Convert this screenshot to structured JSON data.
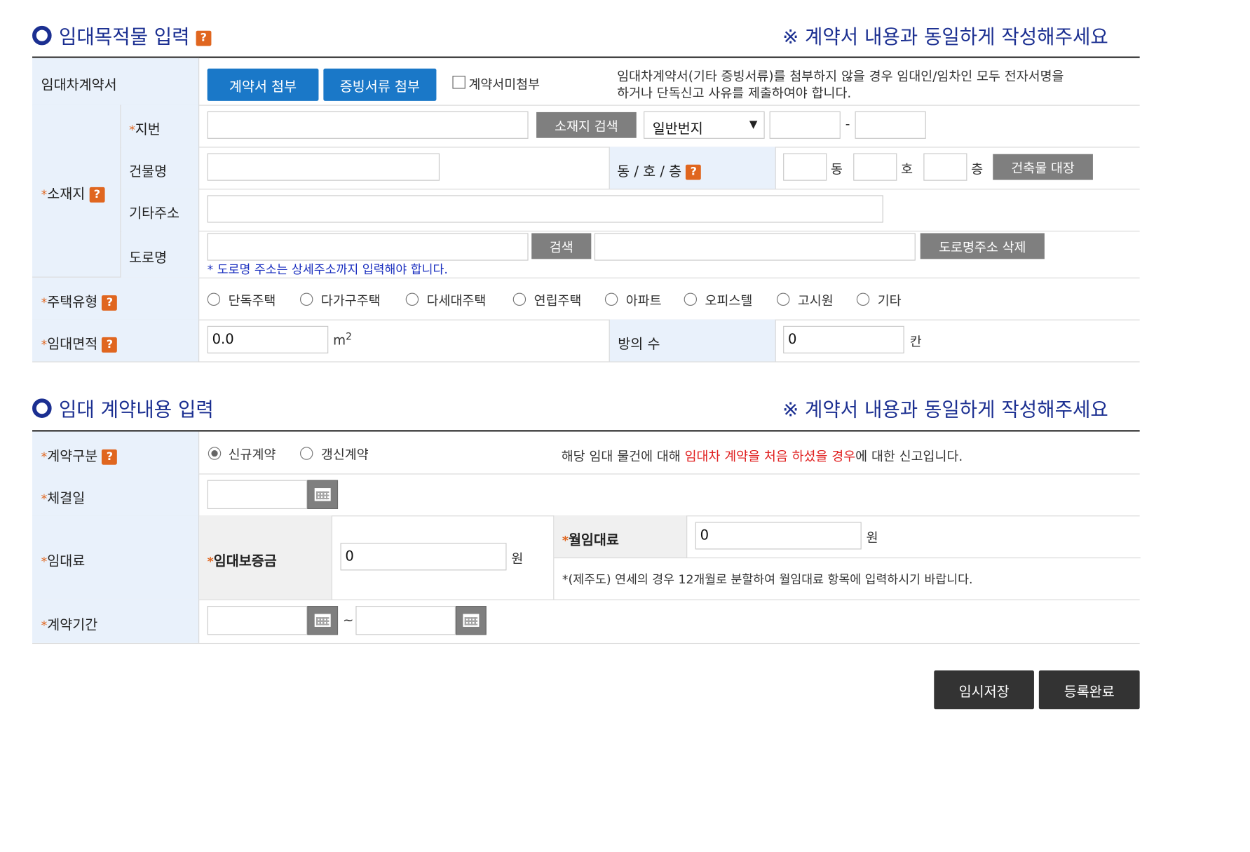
{
  "section1": {
    "title": "임대목적물 입력",
    "notice": "※ 계약서 내용과 동일하게 작성해주세요",
    "help": "?",
    "contract_label": "임대차계약서",
    "attach_contract_btn": "계약서 첨부",
    "attach_evidence_btn": "증빙서류 첨부",
    "no_attach_label": "계약서미첨부",
    "attach_note_1": "임대차계약서(기타 증빙서류)를 첨부하지 않을 경우 임대인/임차인 모두 전자서명을",
    "attach_note_2": "하거나 단독신고 사유를 제출하여야 합니다.",
    "location_label": "소재지",
    "jibun_label": "지번",
    "search_location_btn": "소재지 검색",
    "jibun_type_selected": "일반번지",
    "dash": "-",
    "building_name_label": "건물명",
    "dong_ho_floor_label": "동 / 호 / 층",
    "dong_unit": "동",
    "ho_unit": "호",
    "floor_unit": "층",
    "building_register_btn": "건축물 대장",
    "other_address_label": "기타주소",
    "road_label": "도로명",
    "road_search_btn": "검색",
    "road_delete_btn": "도로명주소 삭제",
    "road_note": "* 도로명 주소는 상세주소까지 입력해야 합니다.",
    "housing_type_label": "주택유형",
    "housing_types": [
      "단독주택",
      "다가구주택",
      "다세대주택",
      "연립주택",
      "아파트",
      "오피스텔",
      "고시원",
      "기타"
    ],
    "area_label": "임대면적",
    "area_value": "0.0",
    "area_unit": "m",
    "area_unit_sup": "2",
    "rooms_label": "방의 수",
    "rooms_value": "0",
    "rooms_unit": "칸"
  },
  "section2": {
    "title": "임대 계약내용 입력",
    "notice": "※ 계약서 내용과 동일하게 작성해주세요",
    "contract_type_label": "계약구분",
    "contract_types": [
      "신규계약",
      "갱신계약"
    ],
    "contract_type_selected": "신규계약",
    "contract_note_pre": "해당 임대 물건에 대해 ",
    "contract_note_red": "임대차 계약을 처음 하셨을 경우",
    "contract_note_post": "에 대한 신고입니다.",
    "conclusion_date_label": "체결일",
    "rent_label": "임대료",
    "deposit_label": "임대보증금",
    "deposit_value": "0",
    "won": "원",
    "monthly_rent_label": "월임대료",
    "monthly_rent_value": "0",
    "monthly_note": "*(제주도) 연세의 경우 12개월로 분할하여 월임대료 항목에 입력하시기 바랍니다.",
    "period_label": "계약기간",
    "tilde": "~"
  },
  "footer": {
    "temp_save_btn": "임시저장",
    "register_btn": "등록완료"
  },
  "colors": {
    "accent": "#1b2f91",
    "help": "#e0661f",
    "blue_button": "#1a78c8",
    "label_bg": "#e9f1fb"
  }
}
